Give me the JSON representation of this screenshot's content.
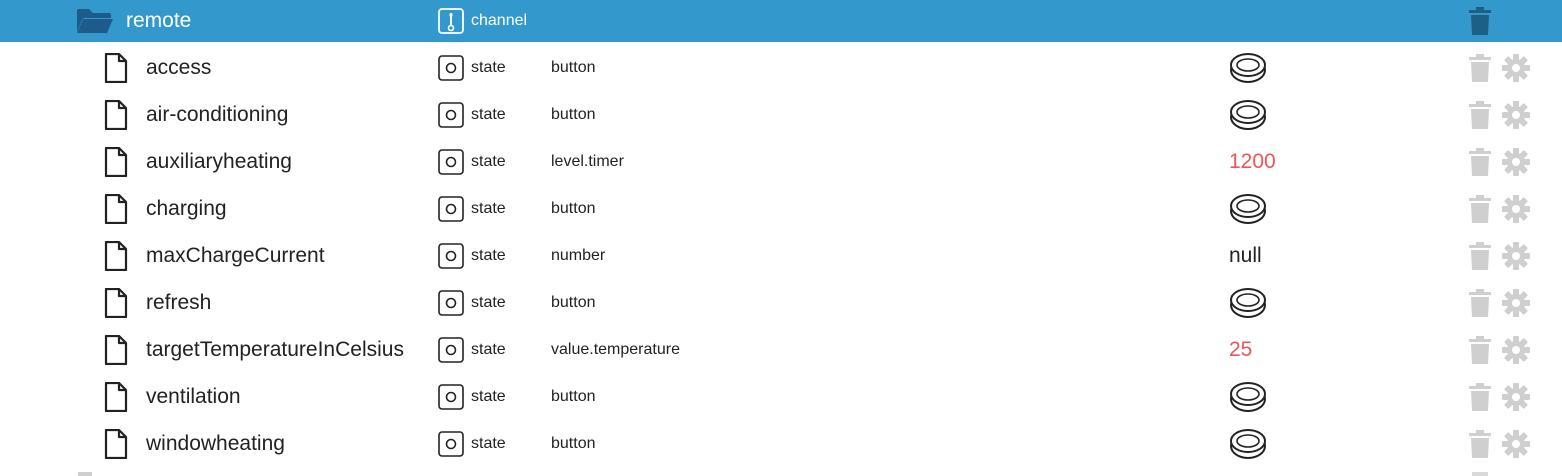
{
  "channel": {
    "name": "remote",
    "type": "channel",
    "icons": {
      "folder": "folder-open-icon",
      "type": "channel-icon",
      "delete": "trash-icon"
    },
    "colors": {
      "header_bg": "#3399cc",
      "header_text": "#ffffff",
      "delete_icon": "#1e5f85"
    }
  },
  "states": [
    {
      "name": "access",
      "type": "state",
      "role": "button",
      "value": "",
      "value_kind": "button"
    },
    {
      "name": "air-conditioning",
      "type": "state",
      "role": "button",
      "value": "",
      "value_kind": "button"
    },
    {
      "name": "auxiliaryheating",
      "type": "state",
      "role": "level.timer",
      "value": "1200",
      "value_kind": "number"
    },
    {
      "name": "charging",
      "type": "state",
      "role": "button",
      "value": "",
      "value_kind": "button"
    },
    {
      "name": "maxChargeCurrent",
      "type": "state",
      "role": "number",
      "value": "null",
      "value_kind": "null"
    },
    {
      "name": "refresh",
      "type": "state",
      "role": "button",
      "value": "",
      "value_kind": "button"
    },
    {
      "name": "targetTemperatureInCelsius",
      "type": "state",
      "role": "value.temperature",
      "value": "25",
      "value_kind": "number"
    },
    {
      "name": "ventilation",
      "type": "state",
      "role": "button",
      "value": "",
      "value_kind": "button"
    },
    {
      "name": "windowheating",
      "type": "state",
      "role": "button",
      "value": "",
      "value_kind": "button"
    }
  ],
  "icons": {
    "file": "file-icon",
    "state": "state-icon",
    "button_value": "push-button-icon",
    "delete": "trash-icon",
    "edit": "gear-icon"
  },
  "colors": {
    "number_value": "#f05454",
    "action_icons": "#cfcfcf"
  }
}
